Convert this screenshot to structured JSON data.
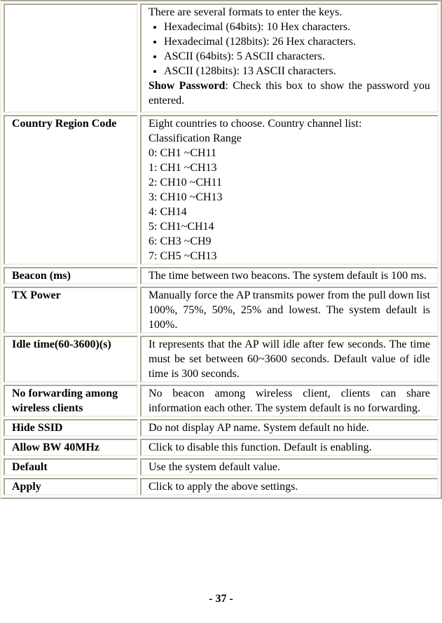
{
  "rows": [
    {
      "name": "",
      "lines": [
        "There are several formats to enter the keys."
      ],
      "bullets": [
        "Hexadecimal (64bits): 10 Hex characters.",
        "Hexadecimal (128bits): 26 Hex characters.",
        "ASCII (64bits): 5 ASCII characters.",
        "ASCII (128bits): 13 ASCII characters."
      ],
      "bold_lead": "Show Password",
      "tail": ": Check this box to show the password you entered."
    },
    {
      "name": "Country Region Code",
      "lines": [
        "Eight countries to choose. Country channel list:",
        "Classification Range",
        "0: CH1 ~CH11",
        "1: CH1 ~CH13",
        "2: CH10 ~CH11",
        "3: CH10 ~CH13",
        "4: CH14",
        "5: CH1~CH14",
        "6: CH3 ~CH9",
        "7: CH5 ~CH13"
      ]
    },
    {
      "name": "Beacon (ms)",
      "text": "The time between two beacons. The system default is 100 ms."
    },
    {
      "name": "TX Power",
      "text": "Manually force the AP transmits power from the pull down list 100%, 75%, 50%, 25% and lowest. The system default is 100%."
    },
    {
      "name": "Idle time(60-3600)(s)",
      "text": "It represents that the AP will idle after few seconds. The time must be set between 60~3600 seconds. Default value of idle time is 300 seconds."
    },
    {
      "name": "No forwarding among wireless clients",
      "text": "No beacon among wireless client, clients can share information each other. The system default is no forwarding."
    },
    {
      "name": "Hide SSID",
      "text": "Do not display AP name. System default no hide."
    },
    {
      "name": "Allow BW 40MHz",
      "text": "Click to disable this function. Default is enabling."
    },
    {
      "name": "Default",
      "text": "Use the system default value."
    },
    {
      "name": "Apply",
      "text": "Click to apply the above settings."
    }
  ],
  "page_number": "- 37 -"
}
